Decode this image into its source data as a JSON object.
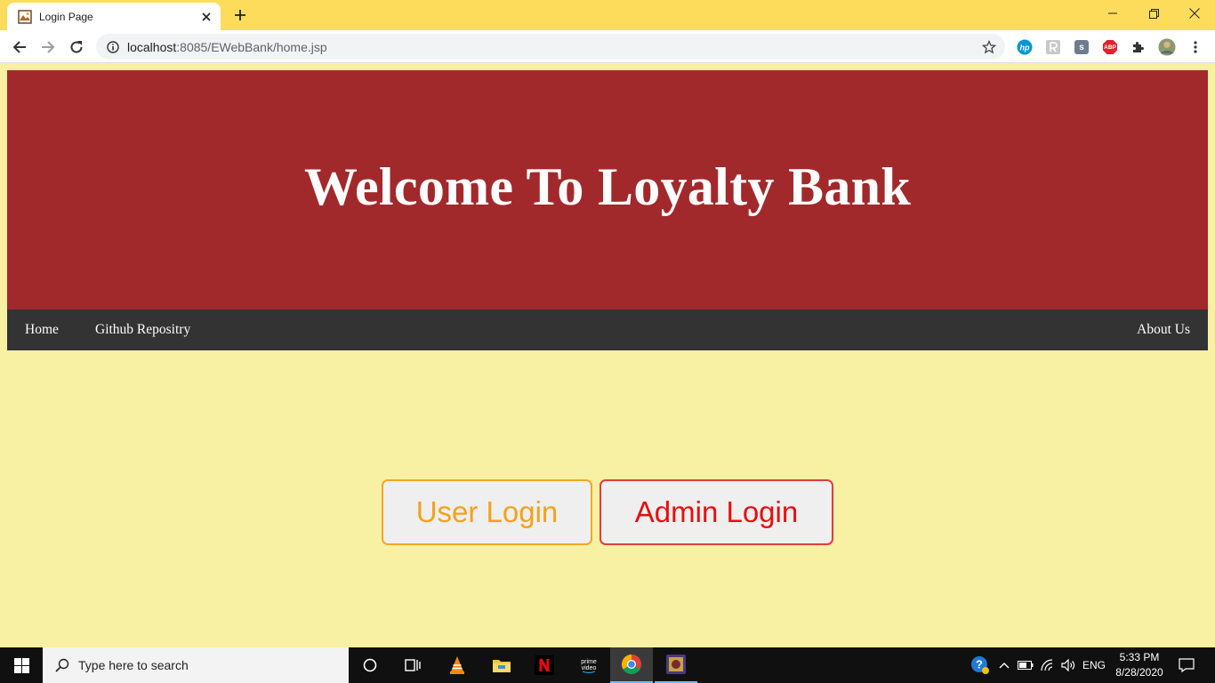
{
  "browser": {
    "tab_title": "Login Page",
    "url_host": "localhost",
    "url_rest": ":8085/EWebBank/home.jsp",
    "extensions": [
      "hp-icon",
      "readability-icon",
      "s-extension-icon",
      "abp-icon",
      "puzzle-icon",
      "profile-avatar"
    ],
    "abp_label": "ABP",
    "s_label": "s"
  },
  "page": {
    "header_title": "Welcome To Loyalty Bank",
    "nav": {
      "home": "Home",
      "github": "Github Repositry",
      "about": "About Us"
    },
    "buttons": {
      "user_login": "User Login",
      "admin_login": "Admin Login"
    },
    "colors": {
      "background": "#f8f0a2",
      "header": "#a2292b",
      "navbar": "#333333",
      "user_button": "#f4a11c",
      "admin_button": "#e80e0e"
    }
  },
  "taskbar": {
    "search_placeholder": "Type here to search",
    "language": "ENG",
    "time": "5:33 PM",
    "date": "8/28/2020"
  }
}
